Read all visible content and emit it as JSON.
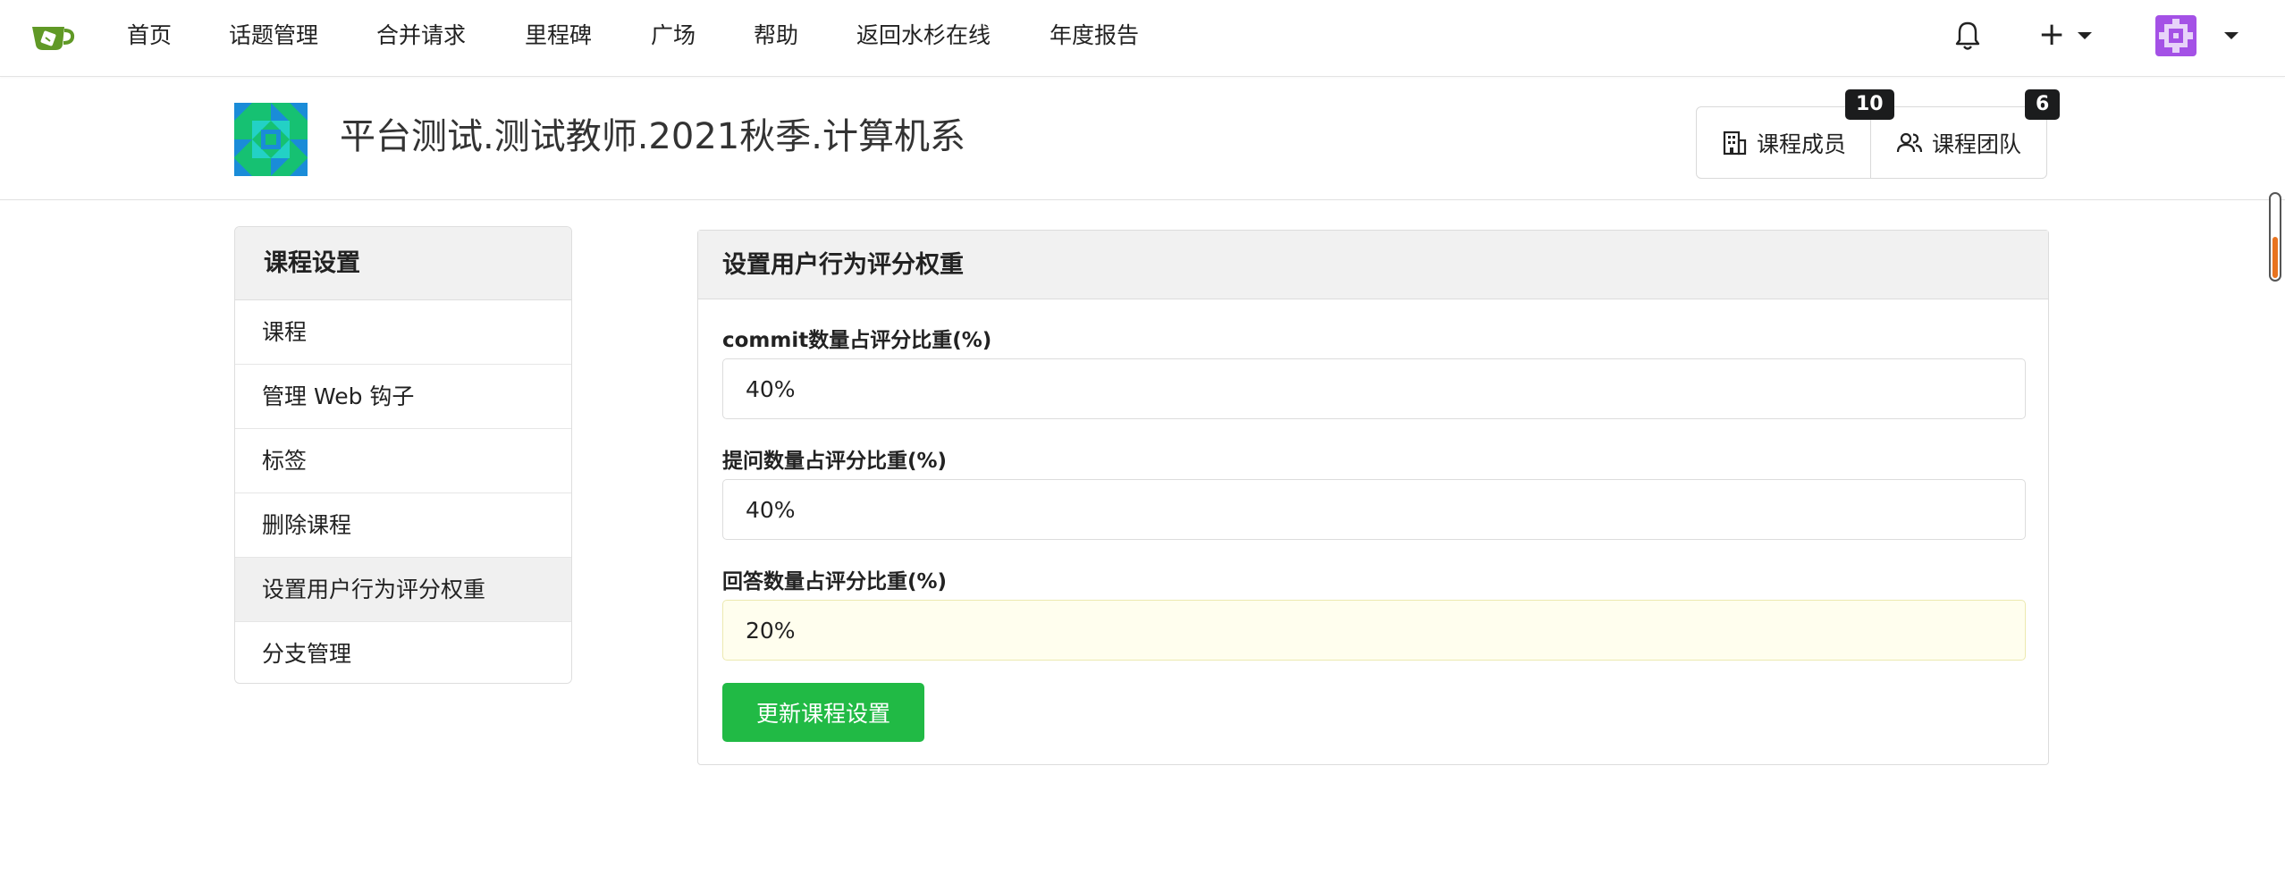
{
  "nav": {
    "items": [
      "首页",
      "话题管理",
      "合并请求",
      "里程碑",
      "广场",
      "帮助",
      "返回水杉在线",
      "年度报告"
    ],
    "icons": [
      "logo-icon",
      "bell-icon",
      "plus-icon",
      "avatar"
    ]
  },
  "repo": {
    "title": "平台测试.测试教师.2021秋季.计算机系",
    "members_label": "课程成员",
    "members_count": "10",
    "team_label": "课程团队",
    "team_count": "6"
  },
  "sidebar": {
    "title": "课程设置",
    "items": [
      {
        "label": "课程",
        "active": false
      },
      {
        "label": "管理 Web 钩子",
        "active": false
      },
      {
        "label": "标签",
        "active": false
      },
      {
        "label": "删除课程",
        "active": false
      },
      {
        "label": "设置用户行为评分权重",
        "active": true
      },
      {
        "label": "分支管理",
        "active": false
      }
    ]
  },
  "form": {
    "title": "设置用户行为评分权重",
    "fields": [
      {
        "label": "commit数量占评分比重(%)",
        "value": "40%"
      },
      {
        "label": "提问数量占评分比重(%)",
        "value": "40%"
      },
      {
        "label": "回答数量占评分比重(%)",
        "value": "20%"
      }
    ],
    "submit_label": "更新课程设置"
  },
  "colors": {
    "primary_button": "#21ba45",
    "focused_field_bg": "#fffeee",
    "header_bg": "#f1f1f1",
    "count_badge": "#1b1c1d",
    "scroll_thumb": "#e8731f"
  }
}
